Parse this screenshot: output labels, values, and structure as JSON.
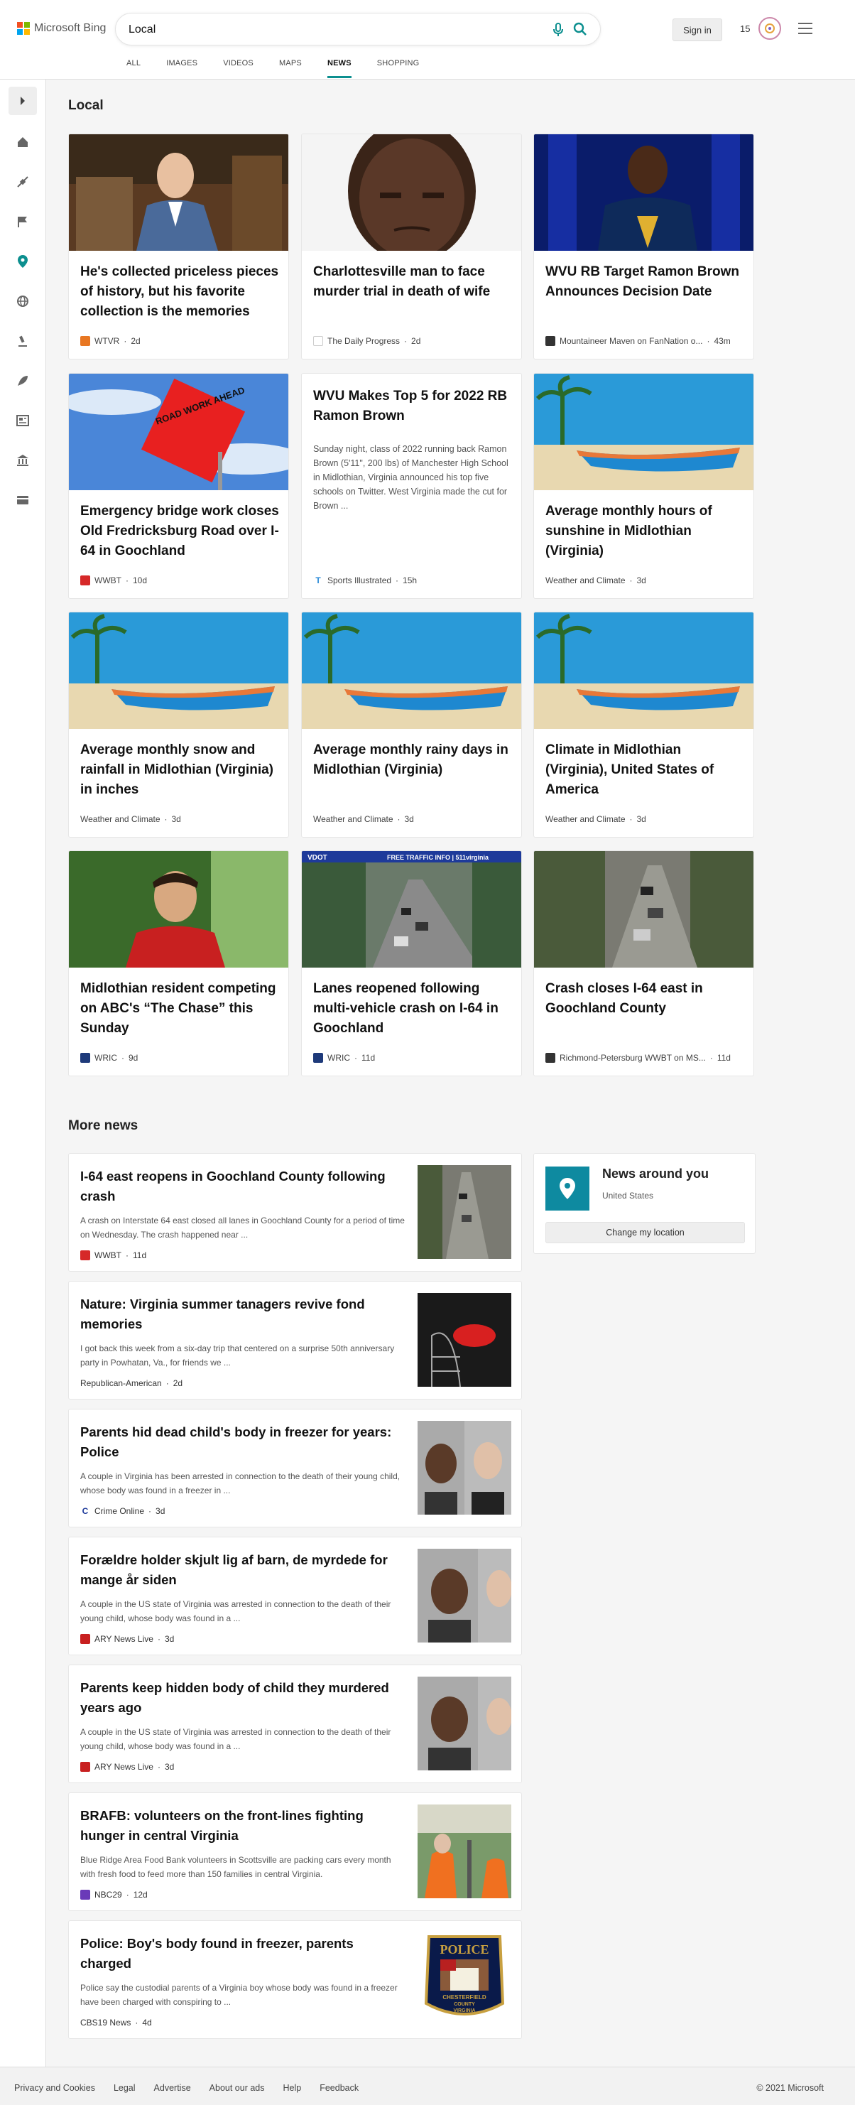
{
  "brand": {
    "name": "Microsoft Bing"
  },
  "search": {
    "query": "Local"
  },
  "header": {
    "signin_label": "Sign in",
    "points": "15"
  },
  "tabs": [
    {
      "label": "ALL"
    },
    {
      "label": "IMAGES"
    },
    {
      "label": "VIDEOS"
    },
    {
      "label": "MAPS"
    },
    {
      "label": "NEWS",
      "active": true
    },
    {
      "label": "SHOPPING"
    }
  ],
  "colors": {
    "accent": "#0c8f8f",
    "pin": "#0e8aa0"
  },
  "leftnav": {
    "icons": [
      "expand-icon",
      "home-icon",
      "satellite-icon",
      "flag-icon",
      "location-pin-icon",
      "globe-icon",
      "microscope-icon",
      "rocket-icon",
      "newspaper-icon",
      "bank-icon",
      "credit-card-icon"
    ]
  },
  "local": {
    "title": "Local",
    "cards": [
      {
        "title": "He's collected priceless pieces of history, but his favorite collection is the memories",
        "source": "WTVR",
        "age": "2d"
      },
      {
        "title": "Charlottesville man to face murder trial in death of wife",
        "source": "The Daily Progress",
        "age": "2d"
      },
      {
        "title": "WVU RB Target Ramon Brown Announces Decision Date",
        "source": "Mountaineer Maven on FanNation o...",
        "age": "43m"
      },
      {
        "title": "Emergency bridge work closes Old Fredricksburg Road over I-64 in Goochland",
        "source": "WWBT",
        "age": "10d",
        "sign_text": "ROAD WORK AHEAD"
      },
      {
        "title": "WVU Makes Top 5 for 2022 RB Ramon Brown",
        "snippet": "Sunday night, class of 2022 running back Ramon Brown (5'11\", 200 lbs) of Manchester High School in Midlothian, Virginia announced his top five schools on Twitter. West Virginia made the cut for Brown ...",
        "source": "Sports Illustrated",
        "age": "15h"
      },
      {
        "title": "Average monthly hours of sunshine in Midlothian (Virginia)",
        "source": "Weather and Climate",
        "age": "3d"
      },
      {
        "title": "Average monthly snow and rainfall in Midlothian (Virginia) in inches",
        "source": "Weather and Climate",
        "age": "3d"
      },
      {
        "title": "Average monthly rainy days in Midlothian (Virginia)",
        "source": "Weather and Climate",
        "age": "3d"
      },
      {
        "title": "Climate in Midlothian (Virginia), United States of America",
        "source": "Weather and Climate",
        "age": "3d"
      },
      {
        "title": "Midlothian resident competing on ABC's “The Chase” this Sunday",
        "source": "WRIC",
        "age": "9d"
      },
      {
        "title": "Lanes reopened following multi-vehicle crash on I-64 in Goochland",
        "source": "WRIC",
        "age": "11d",
        "banner": "FREE TRAFFIC INFO | 511virginia",
        "banner_logo": "VDOT"
      },
      {
        "title": "Crash closes I-64 east in Goochland County",
        "source": "Richmond-Petersburg WWBT on MS...",
        "age": "11d"
      }
    ]
  },
  "more": {
    "title": "More news",
    "items": [
      {
        "title": "I-64 east reopens in Goochland County following crash",
        "snippet": "A crash on Interstate 64 east closed all lanes in Goochland County for a period of time on Wednesday. The crash happened near ...",
        "source": "WWBT",
        "age": "11d"
      },
      {
        "title": "Nature: Virginia summer tanagers revive fond memories",
        "snippet": "I got back this week from a six-day trip that centered on a surprise 50th anniversary party in Powhatan, Va., for friends we ...",
        "source": "Republican-American",
        "age": "2d"
      },
      {
        "title": "Parents hid dead child's body in freezer for years: Police",
        "snippet": "A couple in Virginia has been arrested in connection to the death of their young child, whose body was found in a freezer in ...",
        "source": "Crime Online",
        "age": "3d"
      },
      {
        "title": "Forældre holder skjult lig af barn, de myrdede for mange år siden",
        "snippet": "A couple in the US state of Virginia was arrested in connection to the death of their young child, whose body was found in a ...",
        "source": "ARY News Live",
        "age": "3d"
      },
      {
        "title": "Parents keep hidden body of child they murdered years ago",
        "snippet": "A couple in the US state of Virginia was arrested in connection to the death of their young child, whose body was found in a ...",
        "source": "ARY News Live",
        "age": "3d"
      },
      {
        "title": "BRAFB: volunteers on the front-lines fighting hunger in central Virginia",
        "snippet": "Blue Ridge Area Food Bank volunteers in Scottsville are packing cars every month with fresh food to feed more than 150 families in central Virginia.",
        "source": "NBC29",
        "age": "12d"
      },
      {
        "title": "Police: Boy's body found in freezer, parents charged",
        "snippet": "Police say the custodial parents of a Virginia boy whose body was found in a freezer have been charged with conspiring to ...",
        "source": "CBS19 News",
        "age": "4d",
        "badge_top": "POLICE",
        "badge_bottom1": "CHESTERFIELD",
        "badge_bottom2": "COUNTY",
        "badge_bottom3": "VIRGINIA"
      }
    ]
  },
  "around": {
    "title": "News around you",
    "subtitle": "United States",
    "button": "Change my location"
  },
  "footer": {
    "links": [
      "Privacy and Cookies",
      "Legal",
      "Advertise",
      "About our ads",
      "Help",
      "Feedback"
    ],
    "copyright": "© 2021 Microsoft"
  }
}
